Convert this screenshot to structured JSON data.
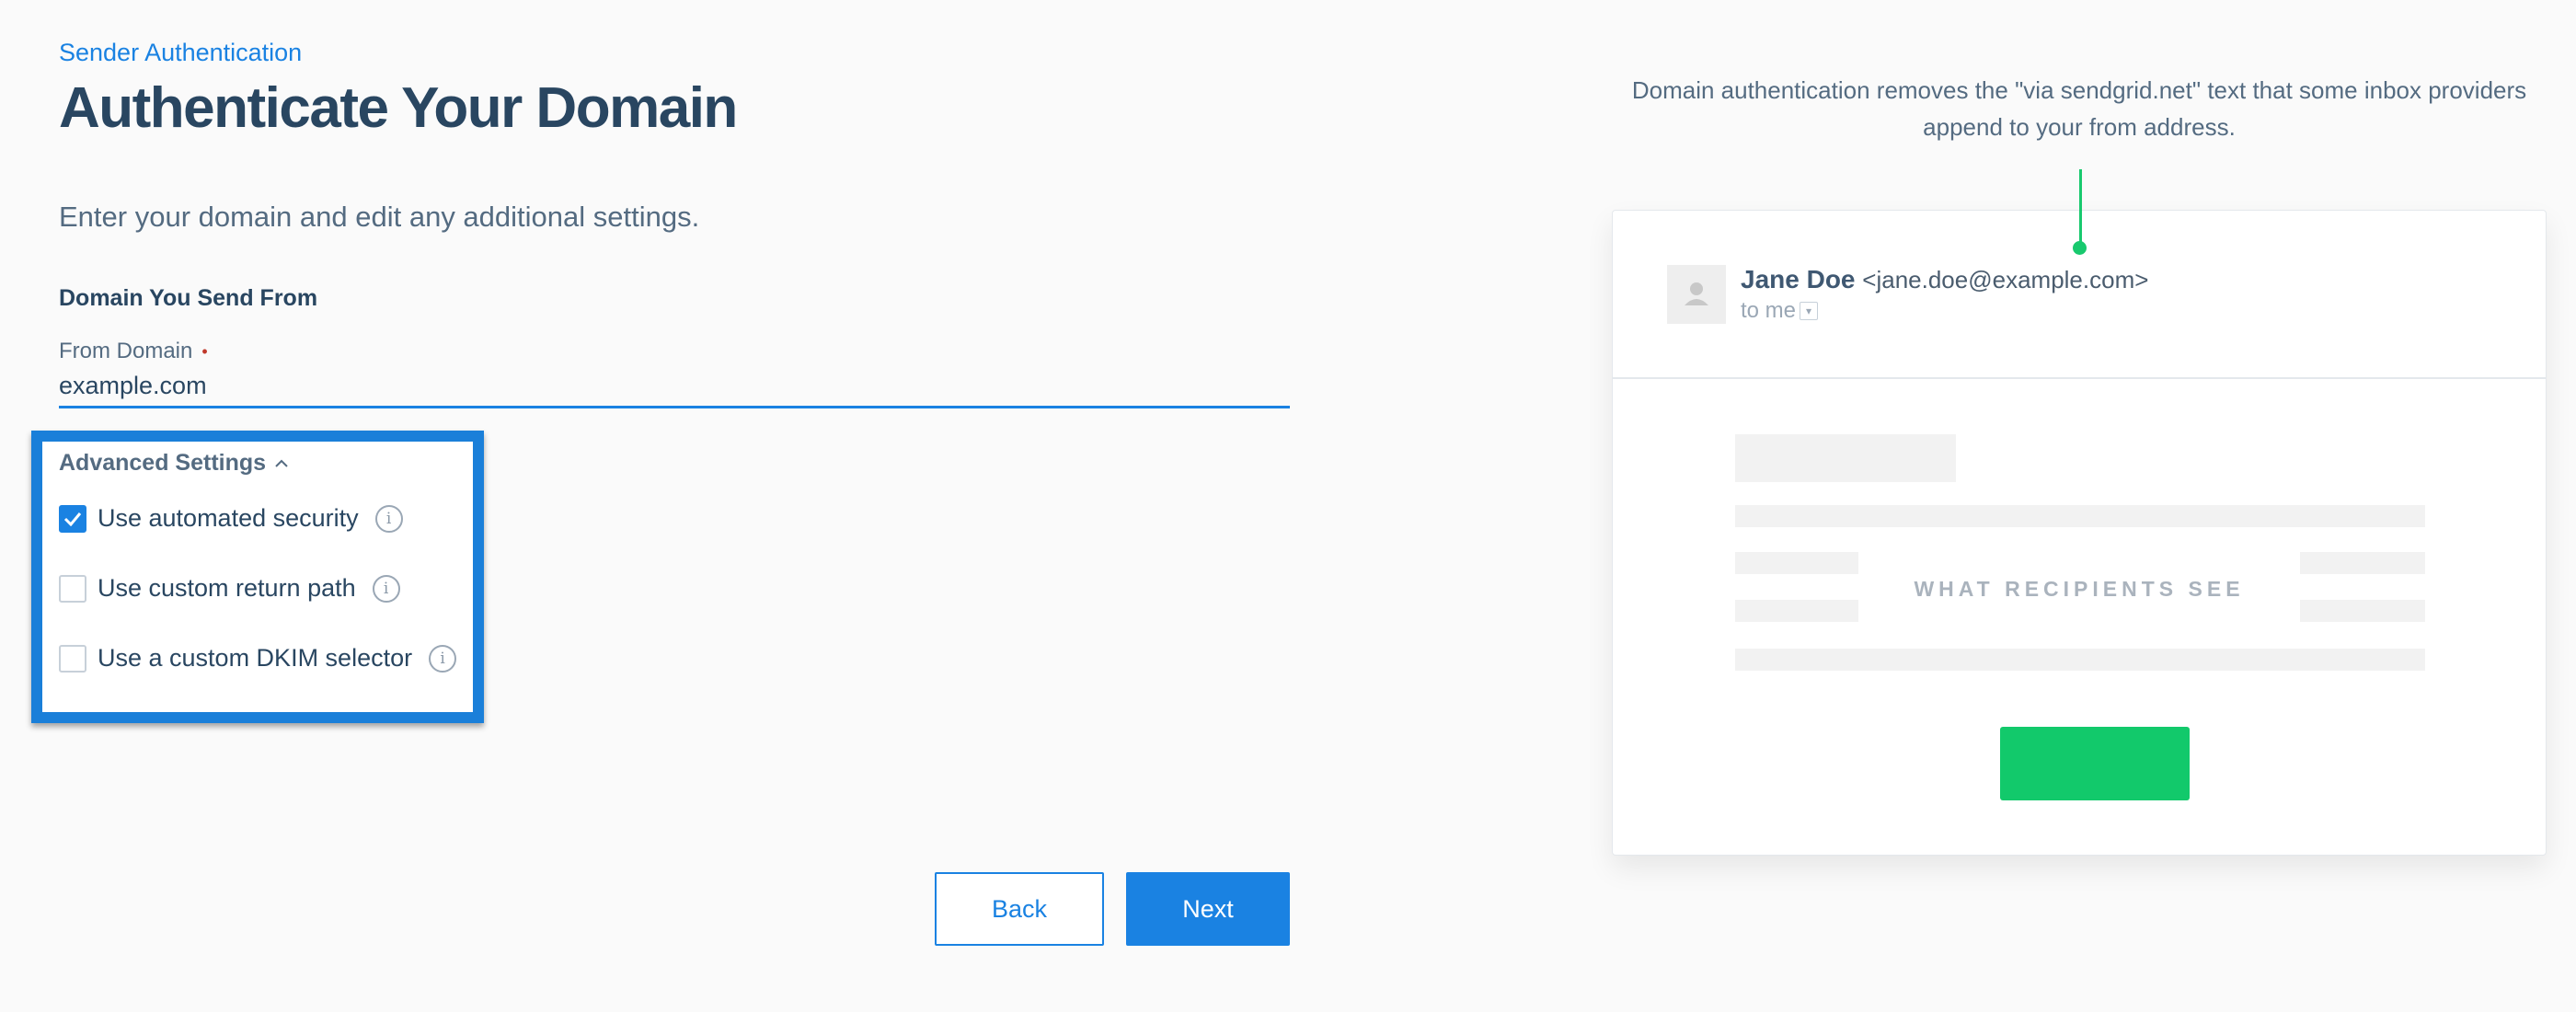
{
  "breadcrumb": "Sender Authentication",
  "page_title": "Authenticate Your Domain",
  "subtitle": "Enter your domain and edit any additional settings.",
  "domain_section": {
    "title": "Domain You Send From",
    "field_label": "From Domain",
    "required_marker": "•",
    "value": "example.com"
  },
  "advanced": {
    "toggle_label": "Advanced Settings",
    "chevron_icon": "chevron-up-icon",
    "options": [
      {
        "label": "Use automated security",
        "checked": true
      },
      {
        "label": "Use custom return path",
        "checked": false
      },
      {
        "label": "Use a custom DKIM selector",
        "checked": false
      }
    ],
    "info_glyph": "i"
  },
  "buttons": {
    "back": "Back",
    "next": "Next"
  },
  "preview": {
    "help_text": "Domain authentication removes the \"via sendgrid.net\" text that some inbox providers append to your from address.",
    "sender_name": "Jane Doe",
    "sender_email": "<jane.doe@example.com>",
    "recipient": "to me",
    "watermark": "WHAT RECIPIENTS SEE"
  },
  "colors": {
    "accent": "#1a82e2",
    "highlight_border": "#1a7fd9",
    "cta_green": "#12c96b",
    "heading": "#294661"
  }
}
